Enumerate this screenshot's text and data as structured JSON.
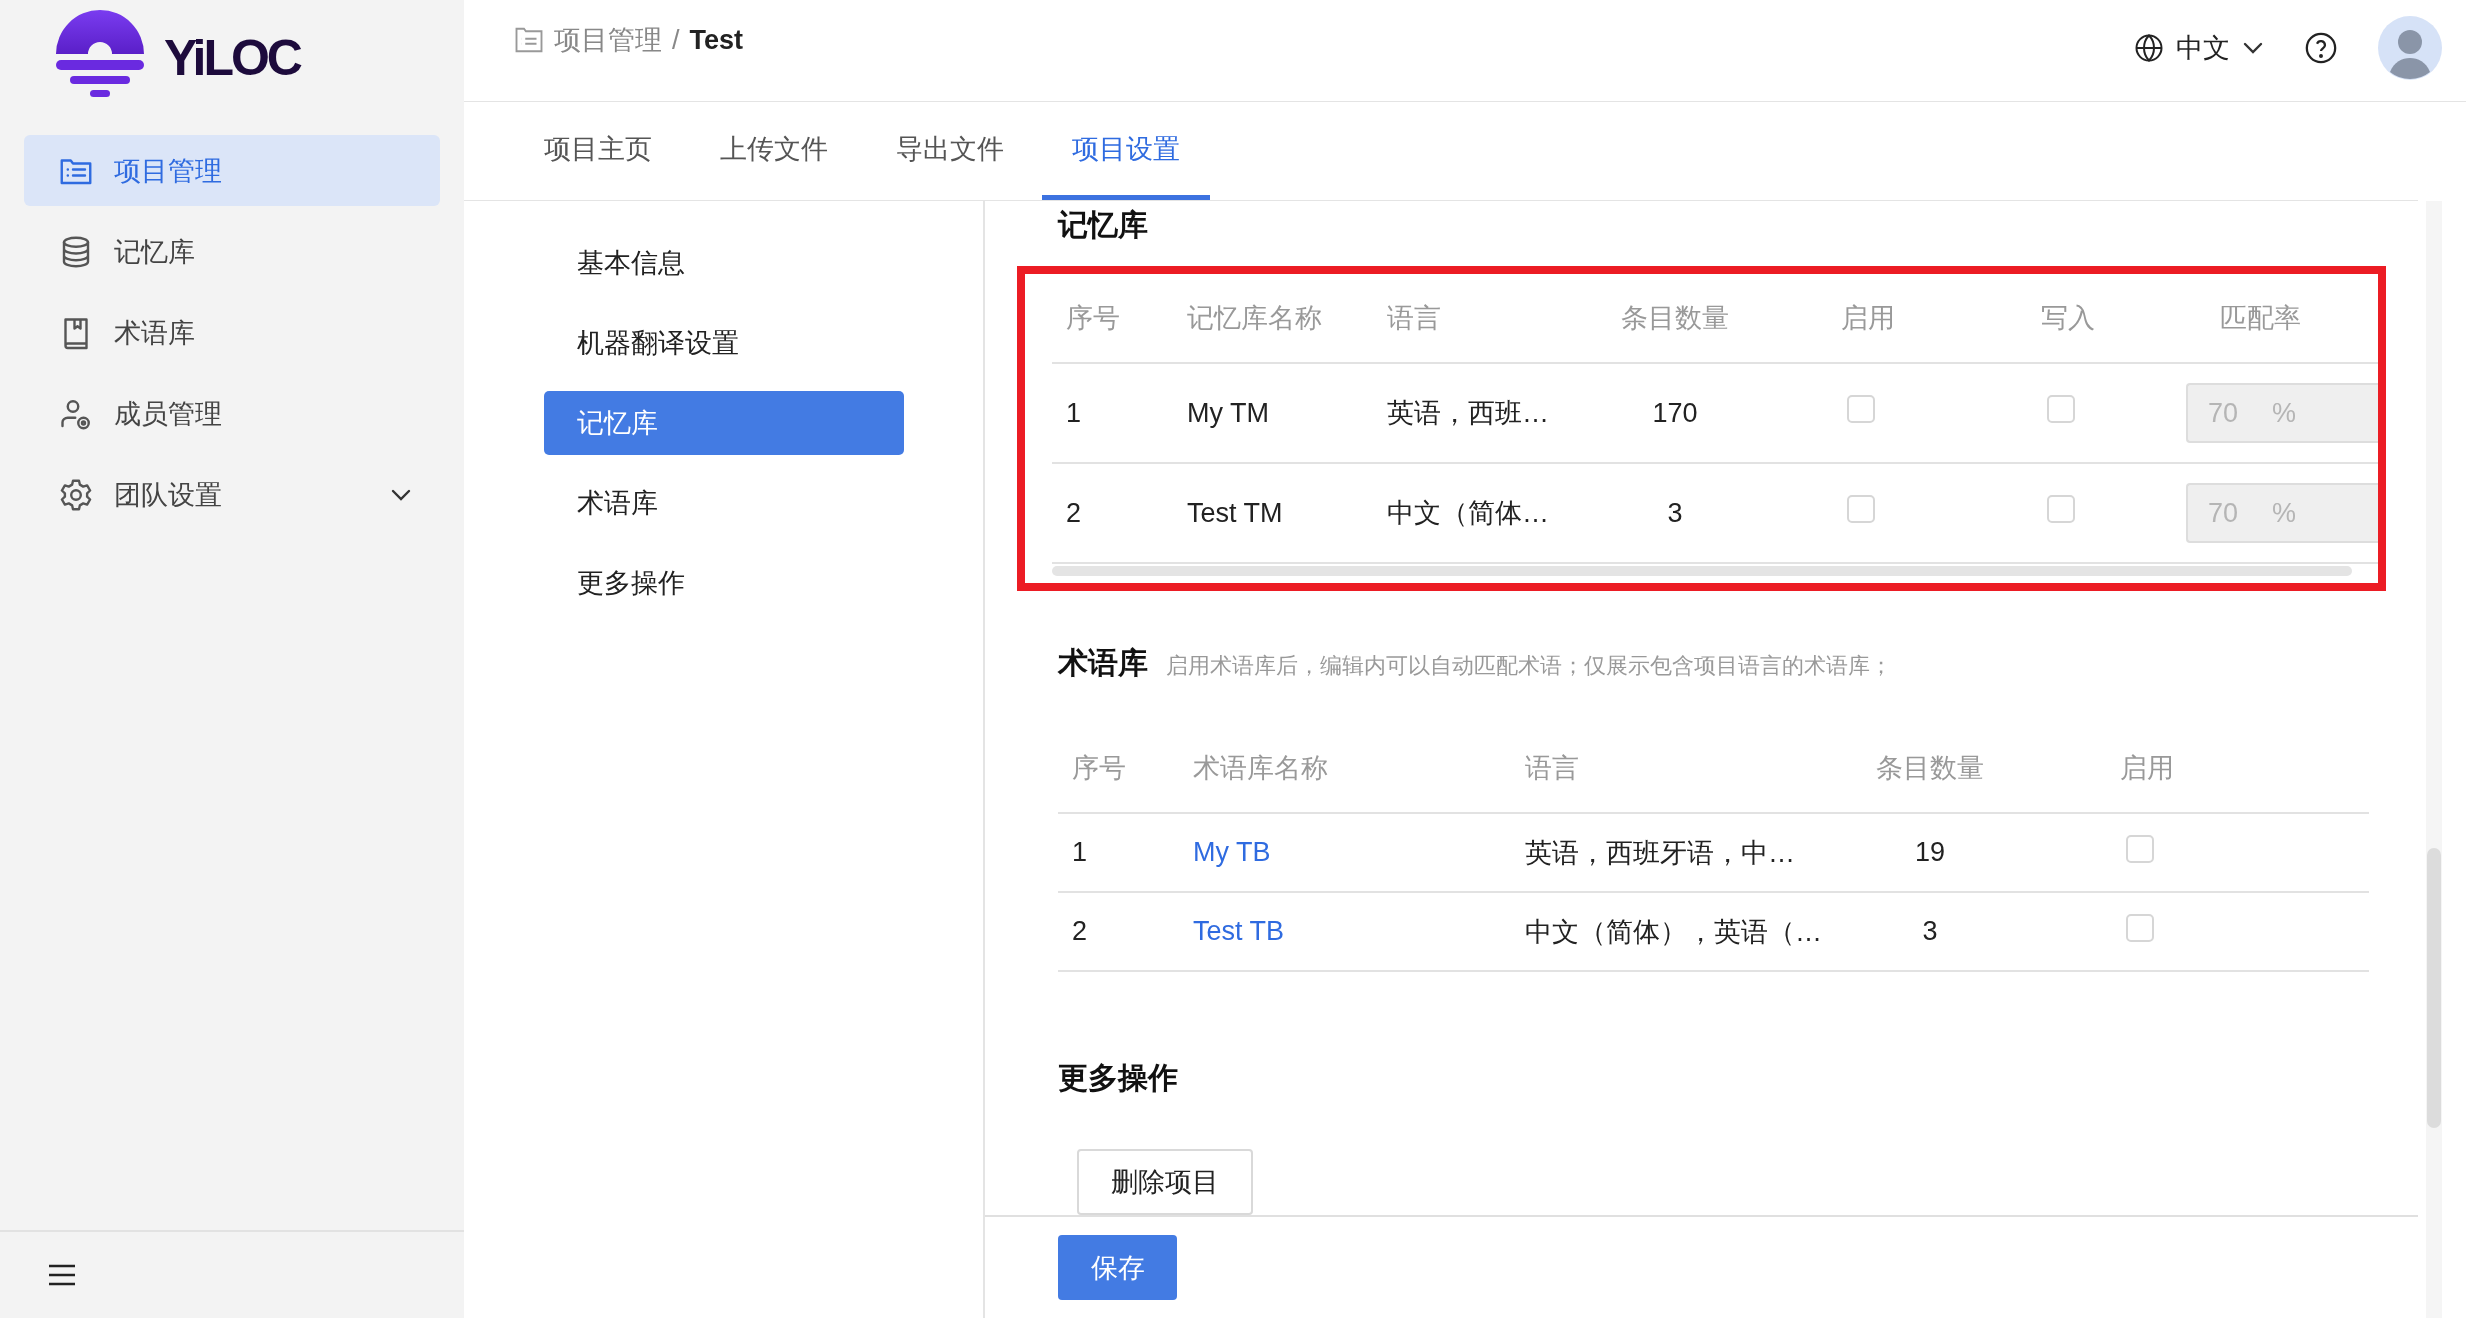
{
  "logo": {
    "text": "YiLOC"
  },
  "sidebar": {
    "items": [
      {
        "kind": "list",
        "label": "项目管理",
        "selected": true,
        "has_submenu": false
      },
      {
        "kind": "database",
        "label": "记忆库",
        "selected": false,
        "has_submenu": false
      },
      {
        "kind": "book",
        "label": "术语库",
        "selected": false,
        "has_submenu": false
      },
      {
        "kind": "member",
        "label": "成员管理",
        "selected": false,
        "has_submenu": false
      },
      {
        "kind": "settings",
        "label": "团队设置",
        "selected": false,
        "has_submenu": true
      }
    ]
  },
  "breadcrumb": {
    "items": [
      "项目管理",
      "Test"
    ],
    "separator": "/"
  },
  "language": "中文",
  "tabs": [
    {
      "label": "项目主页",
      "selected": false
    },
    {
      "label": "上传文件",
      "selected": false
    },
    {
      "label": "导出文件",
      "selected": false
    },
    {
      "label": "项目设置",
      "selected": true
    }
  ],
  "settings_nav": [
    {
      "label": "基本信息",
      "selected": false
    },
    {
      "label": "机器翻译设置",
      "selected": false
    },
    {
      "label": "记忆库",
      "selected": true
    },
    {
      "label": "术语库",
      "selected": false
    },
    {
      "label": "更多操作",
      "selected": false
    }
  ],
  "tm_section": {
    "title": "记忆库",
    "highlighted": true,
    "columns": [
      "序号",
      "记忆库名称",
      "语言",
      "条目数量",
      "启用",
      "写入",
      "匹配率"
    ],
    "rows": [
      {
        "index": "1",
        "name": "My TM",
        "languages": "英语，西班…",
        "count": "170",
        "enabled": false,
        "write": false,
        "match_rate": "70",
        "unit": "%",
        "rate_disabled": true
      },
      {
        "index": "2",
        "name": "Test TM",
        "languages": "中文（简体…",
        "count": "3",
        "enabled": false,
        "write": false,
        "match_rate": "70",
        "unit": "%",
        "rate_disabled": true
      }
    ]
  },
  "tb_section": {
    "title": "术语库",
    "hint": "启用术语库后，编辑内可以自动匹配术语；仅展示包含项目语言的术语库；",
    "columns": [
      "序号",
      "术语库名称",
      "语言",
      "条目数量",
      "启用"
    ],
    "rows": [
      {
        "index": "1",
        "name": "My TB",
        "languages": "英语，西班牙语，中…",
        "count": "19",
        "enabled": false
      },
      {
        "index": "2",
        "name": "Test TB",
        "languages": "中文（简体），英语（…",
        "count": "3",
        "enabled": false
      }
    ]
  },
  "more_section": {
    "title": "更多操作",
    "delete_button": "删除项目"
  },
  "save_button": "保存"
}
